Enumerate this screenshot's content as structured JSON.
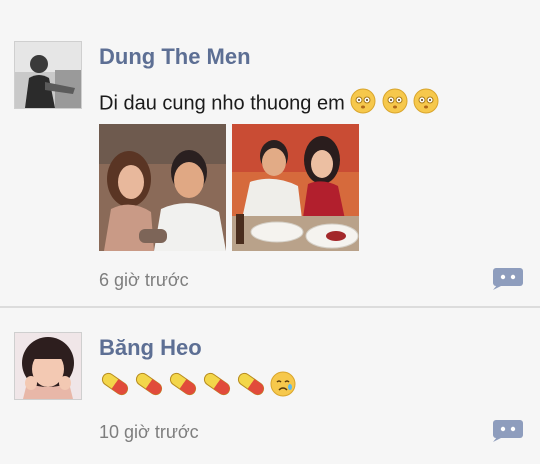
{
  "posts": [
    {
      "author": "Dung The Men",
      "text": "Di dau cung nho thuong em",
      "time": "6 giờ trước",
      "icons": [
        "avatar-photo",
        "smiley-emoji",
        "smiley-emoji",
        "smiley-emoji",
        "photo-thumbnail",
        "photo-thumbnail",
        "comment-bubble-icon"
      ]
    },
    {
      "author": "Băng Heo",
      "time": "10 giờ trước",
      "icons": [
        "avatar-photo",
        "pill-emoji",
        "pill-emoji",
        "pill-emoji",
        "pill-emoji",
        "pill-emoji",
        "crying-face-emoji",
        "comment-bubble-icon"
      ]
    }
  ],
  "colors": {
    "name": "#5d6f94",
    "accent_button": "#8e9dbd",
    "background": "#f6f6f6"
  }
}
